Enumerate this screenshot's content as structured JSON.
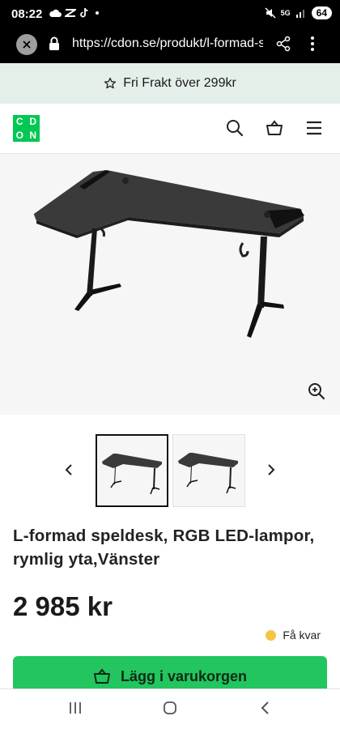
{
  "status_bar": {
    "time": "08:22",
    "battery": "64",
    "network": "5G"
  },
  "browser": {
    "url": "https://cdon.se/produkt/l-formad-speldesk"
  },
  "promo": {
    "text": "Fri Frakt över 299kr"
  },
  "header": {
    "logo_letters": [
      "C",
      "D",
      "O",
      "N"
    ]
  },
  "product": {
    "title": "L-formad speldesk, RGB LED-lam­por, rymlig yta,Vänster",
    "price": "2 985 kr",
    "stock_status": "Få kvar",
    "add_to_cart_label": "Lägg i varukorgen"
  },
  "colors": {
    "brand_green": "#00c853",
    "cta_green": "#22c55e",
    "promo_bg": "#e4efea",
    "stock_dot": "#f5c542"
  }
}
